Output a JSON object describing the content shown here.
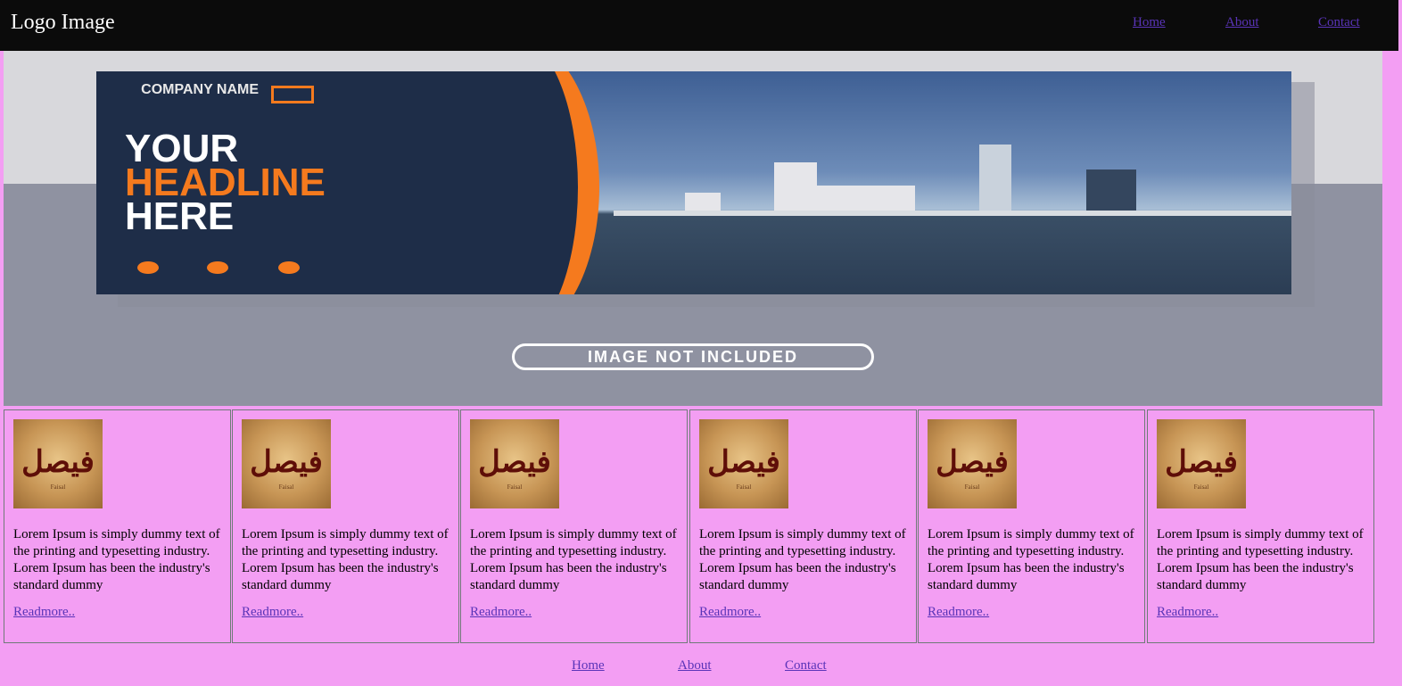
{
  "header": {
    "logo_text": "Logo Image",
    "nav": [
      {
        "label": "Home"
      },
      {
        "label": "About"
      },
      {
        "label": "Contact"
      }
    ]
  },
  "hero": {
    "company_name": "COMPANY NAME",
    "headline_line1": "YOUR",
    "headline_line2": "HEADLINE",
    "headline_line3": "HERE",
    "watermark": "IMAGE NOT INCLUDED"
  },
  "cards": [
    {
      "image_text": "فيصل",
      "image_caption": "Faisal",
      "text": "Lorem Ipsum is simply dummy text of the printing and typesetting industry. Lorem Ipsum has been the industry's standard dummy",
      "link": "Readmore.."
    },
    {
      "image_text": "فيصل",
      "image_caption": "Faisal",
      "text": "Lorem Ipsum is simply dummy text of the printing and typesetting industry. Lorem Ipsum has been the industry's standard dummy",
      "link": "Readmore.."
    },
    {
      "image_text": "فيصل",
      "image_caption": "Faisal",
      "text": "Lorem Ipsum is simply dummy text of the printing and typesetting industry. Lorem Ipsum has been the industry's standard dummy",
      "link": "Readmore.."
    },
    {
      "image_text": "فيصل",
      "image_caption": "Faisal",
      "text": "Lorem Ipsum is simply dummy text of the printing and typesetting industry. Lorem Ipsum has been the industry's standard dummy",
      "link": "Readmore.."
    },
    {
      "image_text": "فيصل",
      "image_caption": "Faisal",
      "text": "Lorem Ipsum is simply dummy text of the printing and typesetting industry. Lorem Ipsum has been the industry's standard dummy",
      "link": "Readmore.."
    },
    {
      "image_text": "فيصل",
      "image_caption": "Faisal",
      "text": "Lorem Ipsum is simply dummy text of the printing and typesetting industry. Lorem Ipsum has been the industry's standard dummy",
      "link": "Readmore.."
    }
  ],
  "footer": {
    "nav": [
      {
        "label": "Home"
      },
      {
        "label": "About"
      },
      {
        "label": "Contact"
      }
    ]
  },
  "colors": {
    "header_bg": "#0b0b0b",
    "page_bg": "#f39ef3",
    "link": "#5a34b8",
    "banner_navy": "#1e2d48",
    "banner_orange": "#f57a1e"
  }
}
